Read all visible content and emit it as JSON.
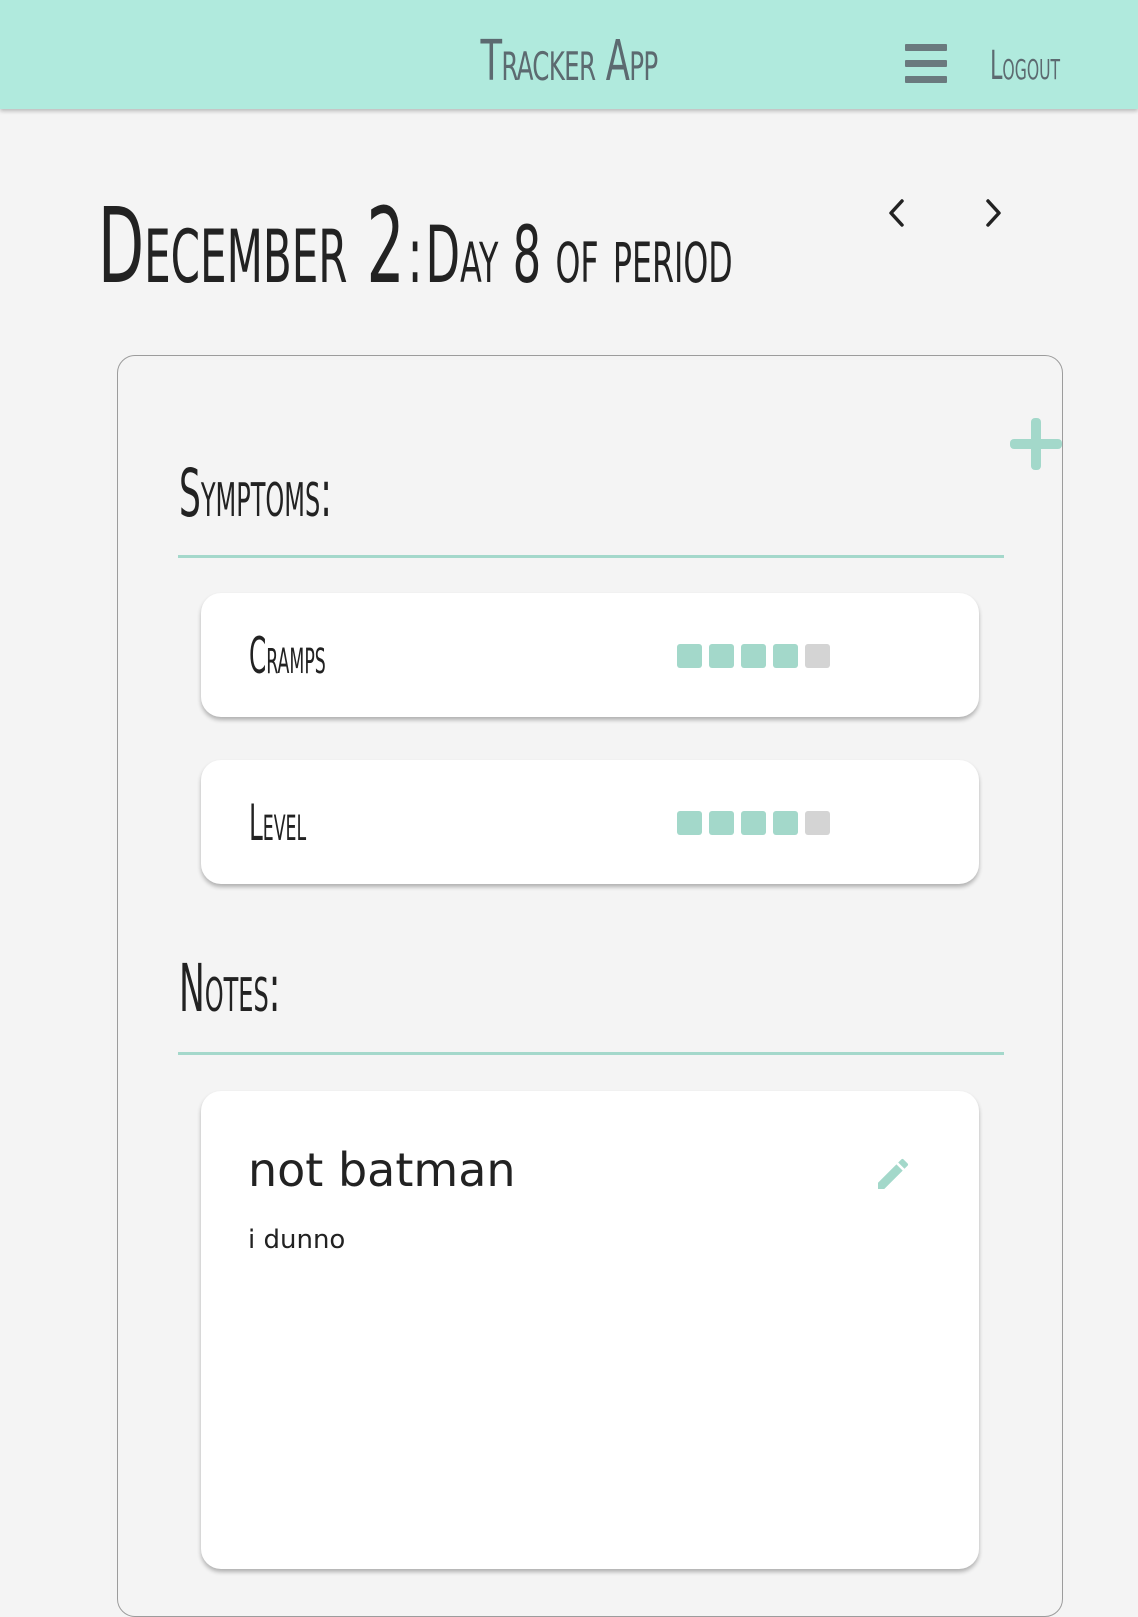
{
  "app": {
    "title": "Tracker App",
    "logout_label": "Logout",
    "menu_icon": "hamburger-menu-icon",
    "accent_color": "#b0eadd",
    "rating_on_color": "#a3d8ca",
    "rating_off_color": "#d4d4d4"
  },
  "day": {
    "date": "December 2",
    "separator": ":",
    "period_text": "Day 8 of period",
    "prev_icon": "chevron-left-icon",
    "next_icon": "chevron-right-icon"
  },
  "add_icon": "plus-icon",
  "symptoms": {
    "title": "Symptoms:",
    "items": [
      {
        "name": "Cramps",
        "rating": 4,
        "max": 5
      },
      {
        "name": "Level",
        "rating": 4,
        "max": 5
      }
    ]
  },
  "notes": {
    "title": "Notes:",
    "items": [
      {
        "title": "not batman",
        "body": "i dunno",
        "edit_icon": "pencil-icon"
      }
    ]
  }
}
